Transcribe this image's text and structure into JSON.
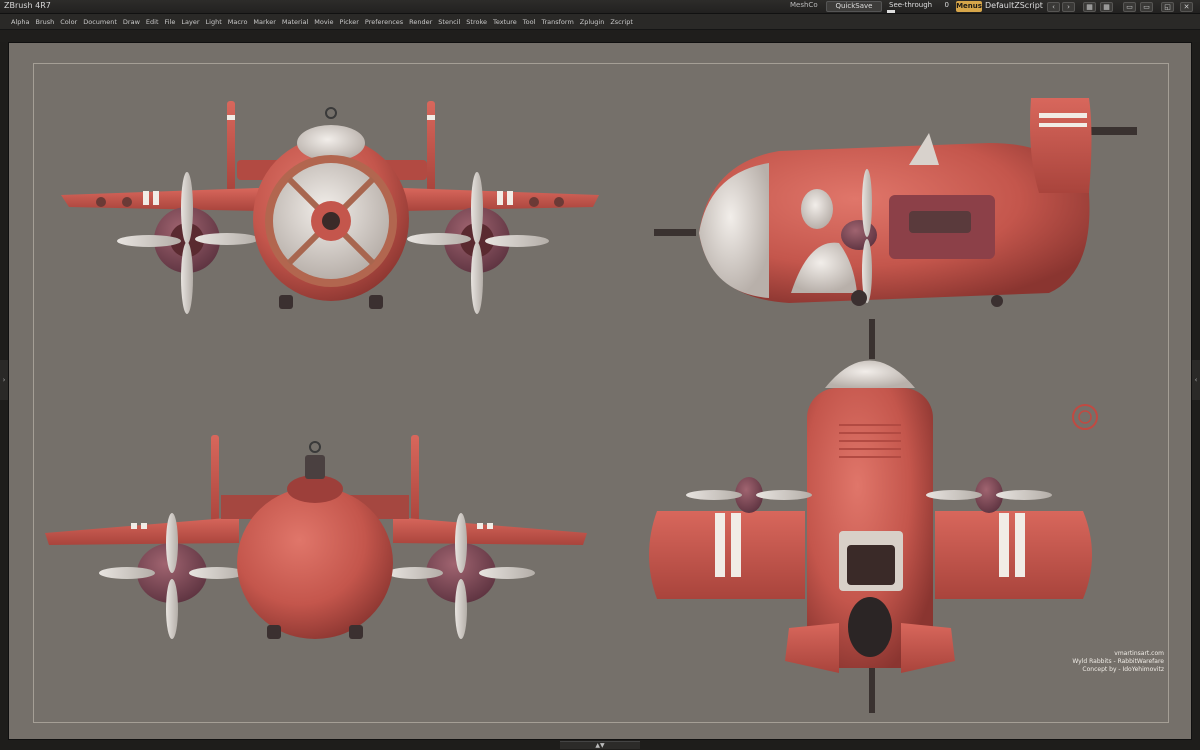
{
  "titlebar": {
    "app_title": "ZBrush 4R7",
    "meshcount": "MeshCo",
    "quicksave": "QuickSave",
    "seethrough_label": "See-through",
    "seethrough_value": "0",
    "menus": "Menus",
    "default_zscript": "DefaultZScript"
  },
  "menubar": {
    "items": [
      "Alpha",
      "Brush",
      "Color",
      "Document",
      "Draw",
      "Edit",
      "File",
      "Layer",
      "Light",
      "Macro",
      "Marker",
      "Material",
      "Movie",
      "Picker",
      "Preferences",
      "Render",
      "Stencil",
      "Stroke",
      "Texture",
      "Tool",
      "Transform",
      "Zplugin",
      "Zscript"
    ]
  },
  "canvas": {
    "background_color": "#75706a",
    "plane_color": "#c4564c",
    "credits": {
      "site": "vmartinsart.com",
      "project": "Wyld Rabbits - RabbitWarefare",
      "concept": "Concept by - IdoYehimovitz"
    }
  },
  "icons": {
    "window_buttons": [
      "pin-icon",
      "layout-icon",
      "palette-icon",
      "config-icon",
      "minimize-icon",
      "maximize-icon",
      "close-icon"
    ],
    "bottom_handle": "expand-tray-icon",
    "side_left": "left-tray-icon",
    "side_right": "right-tray-icon"
  }
}
